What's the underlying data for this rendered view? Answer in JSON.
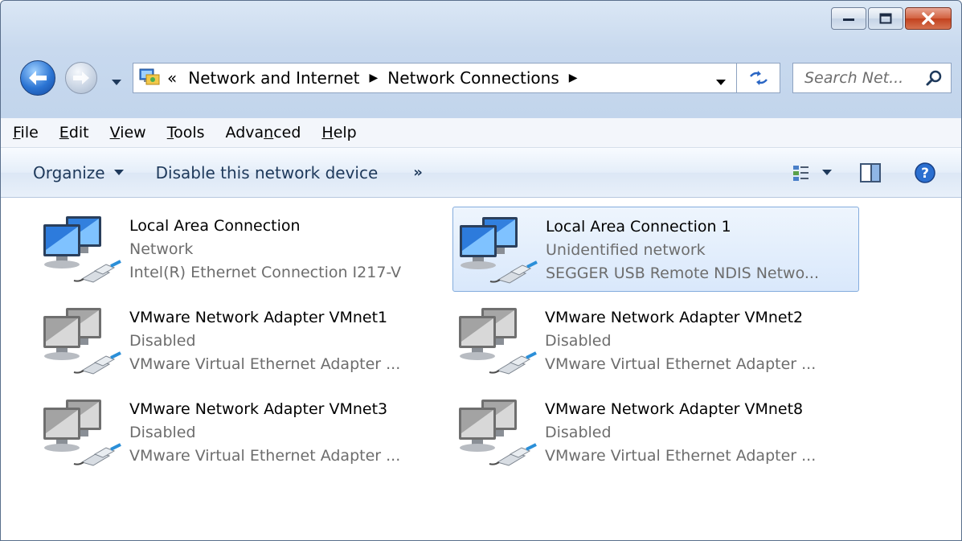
{
  "window": {
    "caption_buttons": [
      "minimize",
      "maximize",
      "close"
    ]
  },
  "navigation": {
    "breadcrumb_overflow": "«",
    "breadcrumb": [
      "Network and Internet",
      "Network Connections"
    ],
    "search_placeholder": "Search Net..."
  },
  "menu": {
    "items": [
      {
        "pre": "",
        "key": "F",
        "post": "ile"
      },
      {
        "pre": "",
        "key": "E",
        "post": "dit"
      },
      {
        "pre": "",
        "key": "V",
        "post": "iew"
      },
      {
        "pre": "",
        "key": "T",
        "post": "ools"
      },
      {
        "pre": "Adva",
        "key": "n",
        "post": "ced"
      },
      {
        "pre": "",
        "key": "H",
        "post": "elp"
      }
    ]
  },
  "commandbar": {
    "organize": "Organize",
    "disable": "Disable this network device",
    "more": "»"
  },
  "connections": [
    {
      "name": "Local Area Connection",
      "status": "Network",
      "device": "Intel(R) Ethernet Connection I217-V",
      "enabled": true,
      "selected": false
    },
    {
      "name": "Local Area Connection 1",
      "status": "Unidentified network",
      "device": "SEGGER USB Remote NDIS Netwo...",
      "enabled": true,
      "selected": true
    },
    {
      "name": "VMware Network Adapter VMnet1",
      "status": "Disabled",
      "device": "VMware Virtual Ethernet Adapter ...",
      "enabled": false,
      "selected": false
    },
    {
      "name": "VMware Network Adapter VMnet2",
      "status": "Disabled",
      "device": "VMware Virtual Ethernet Adapter ...",
      "enabled": false,
      "selected": false
    },
    {
      "name": "VMware Network Adapter VMnet3",
      "status": "Disabled",
      "device": "VMware Virtual Ethernet Adapter ...",
      "enabled": false,
      "selected": false
    },
    {
      "name": "VMware Network Adapter VMnet8",
      "status": "Disabled",
      "device": "VMware Virtual Ethernet Adapter ...",
      "enabled": false,
      "selected": false
    }
  ],
  "colors": {
    "selection_border": "#84acdd",
    "secondary_text": "#6d6d6d",
    "command_text": "#1e395b"
  }
}
